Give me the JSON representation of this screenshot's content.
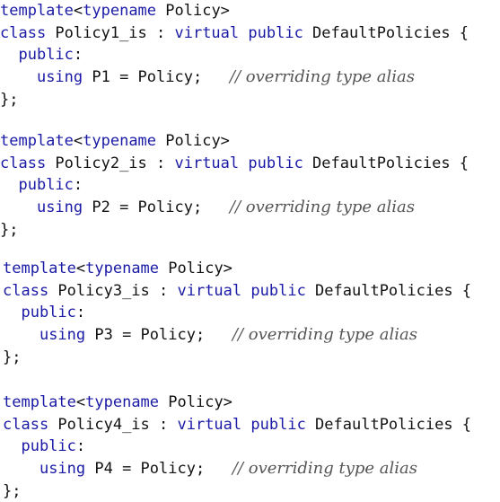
{
  "blocks": [
    {
      "line1": {
        "kw_template": "template",
        "lt": "<",
        "kw_typename": "typename",
        "rest": " Policy>"
      },
      "line2": {
        "kw_class": "class",
        "name": " Policy1_is : ",
        "kw_virtual": "virtual",
        "sp": " ",
        "kw_public": "public",
        "base": " DefaultPolicies {"
      },
      "line3": {
        "indent": "  ",
        "kw_public": "public",
        "colon": ":"
      },
      "line4": {
        "indent": "    ",
        "kw_using": "using",
        "stmt": " P1 = Policy;   ",
        "comment": "// overriding type alias"
      },
      "line5": {
        "close": "};"
      }
    },
    {
      "line1": {
        "kw_template": "template",
        "lt": "<",
        "kw_typename": "typename",
        "rest": " Policy>"
      },
      "line2": {
        "kw_class": "class",
        "name": " Policy2_is : ",
        "kw_virtual": "virtual",
        "sp": " ",
        "kw_public": "public",
        "base": " DefaultPolicies {"
      },
      "line3": {
        "indent": "  ",
        "kw_public": "public",
        "colon": ":"
      },
      "line4": {
        "indent": "    ",
        "kw_using": "using",
        "stmt": " P2 = Policy;   ",
        "comment": "// overriding type alias"
      },
      "line5": {
        "close": "};"
      }
    },
    {
      "line1": {
        "kw_template": "template",
        "lt": "<",
        "kw_typename": "typename",
        "rest": " Policy>"
      },
      "line2": {
        "kw_class": "class",
        "name": " Policy3_is : ",
        "kw_virtual": "virtual",
        "sp": " ",
        "kw_public": "public",
        "base": " DefaultPolicies {"
      },
      "line3": {
        "indent": "  ",
        "kw_public": "public",
        "colon": ":"
      },
      "line4": {
        "indent": "    ",
        "kw_using": "using",
        "stmt": " P3 = Policy;   ",
        "comment": "// overriding type alias"
      },
      "line5": {
        "close": "};"
      }
    },
    {
      "line1": {
        "kw_template": "template",
        "lt": "<",
        "kw_typename": "typename",
        "rest": " Policy>"
      },
      "line2": {
        "kw_class": "class",
        "name": " Policy4_is : ",
        "kw_virtual": "virtual",
        "sp": " ",
        "kw_public": "public",
        "base": " DefaultPolicies {"
      },
      "line3": {
        "indent": "  ",
        "kw_public": "public",
        "colon": ":"
      },
      "line4": {
        "indent": "    ",
        "kw_using": "using",
        "stmt": " P4 = Policy;   ",
        "comment": "// overriding type alias"
      },
      "line5": {
        "close": "};"
      }
    }
  ],
  "colors": {
    "keyword": "#1a1aa6",
    "text": "#111111",
    "comment": "#555555",
    "background": "#ffffff"
  }
}
